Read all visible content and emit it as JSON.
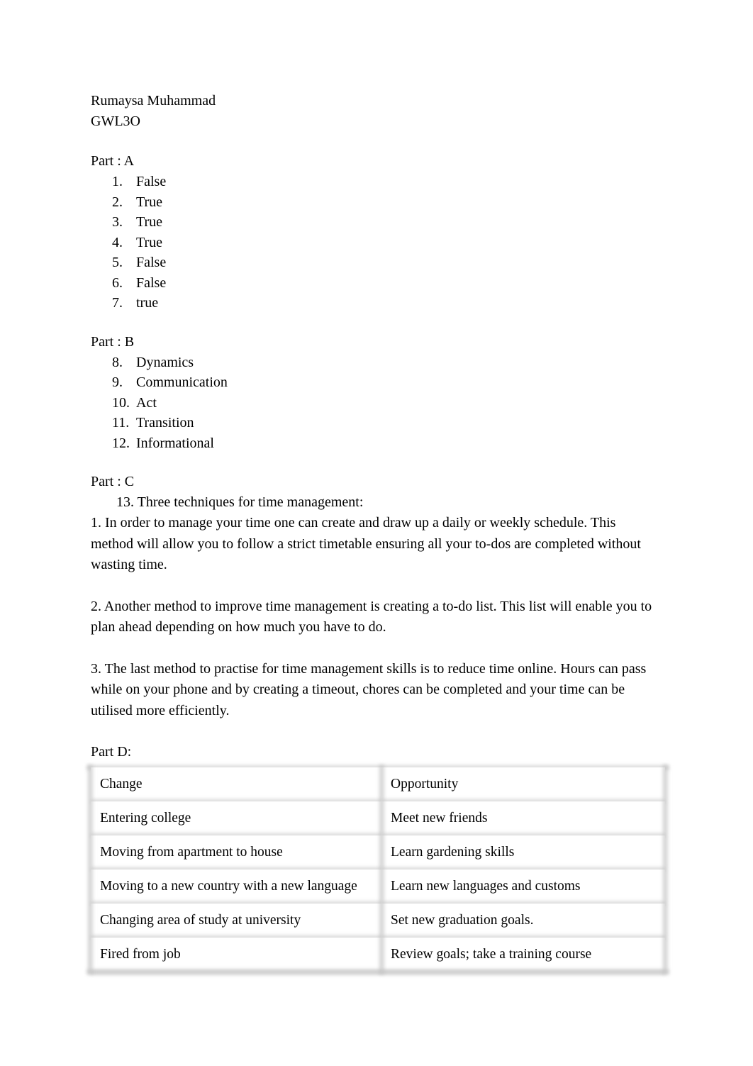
{
  "document": {
    "header": {
      "author": "Rumaysa Muhammad",
      "course_code": "GWL3O"
    },
    "part_a": {
      "heading": "Part : A",
      "items": [
        {
          "number": "1.",
          "answer": "False"
        },
        {
          "number": "2.",
          "answer": "True"
        },
        {
          "number": "3.",
          "answer": "True"
        },
        {
          "number": "4.",
          "answer": "True"
        },
        {
          "number": "5.",
          "answer": "False"
        },
        {
          "number": "6.",
          "answer": "False"
        },
        {
          "number": "7.",
          "answer": "true"
        }
      ]
    },
    "part_b": {
      "heading": "Part : B",
      "items": [
        {
          "number": "8.",
          "answer": "Dynamics"
        },
        {
          "number": "9.",
          "answer": "Communication"
        },
        {
          "number": "10.",
          "answer": "Act"
        },
        {
          "number": "11.",
          "answer": "Transition"
        },
        {
          "number": "12.",
          "answer": "Informational"
        }
      ]
    },
    "part_c": {
      "heading": "Part : C",
      "question_13": "13. Three techniques for time management:",
      "paragraphs": [
        "1. In order to manage your time one can create and draw up a daily or weekly schedule. This method will allow you to follow a strict timetable ensuring all your to-dos are completed without wasting time.",
        "2. Another method to improve time management is creating a to-do list. This list will enable you to plan ahead depending on how much you have to do.",
        "3. The last method to practise for time management skills is to reduce time online. Hours can pass while on your phone and by creating a timeout, chores can be completed and your time can be utilised more efficiently."
      ]
    },
    "part_d": {
      "label": "Part D:",
      "table": {
        "headers": [
          "Change",
          "Opportunity"
        ],
        "rows": [
          [
            "Entering college",
            "Meet new friends"
          ],
          [
            "Moving from apartment to house",
            "Learn gardening skills"
          ],
          [
            "Moving to a new country with a new language",
            "Learn new languages and customs"
          ],
          [
            "Changing area of study at university",
            "Set new graduation goals."
          ],
          [
            "Fired from job",
            "Review goals; take a training course"
          ]
        ]
      }
    }
  },
  "style": {
    "page_background": "#ffffff",
    "text_color": "#000000",
    "table_rule_color": "#c4c4c4"
  }
}
